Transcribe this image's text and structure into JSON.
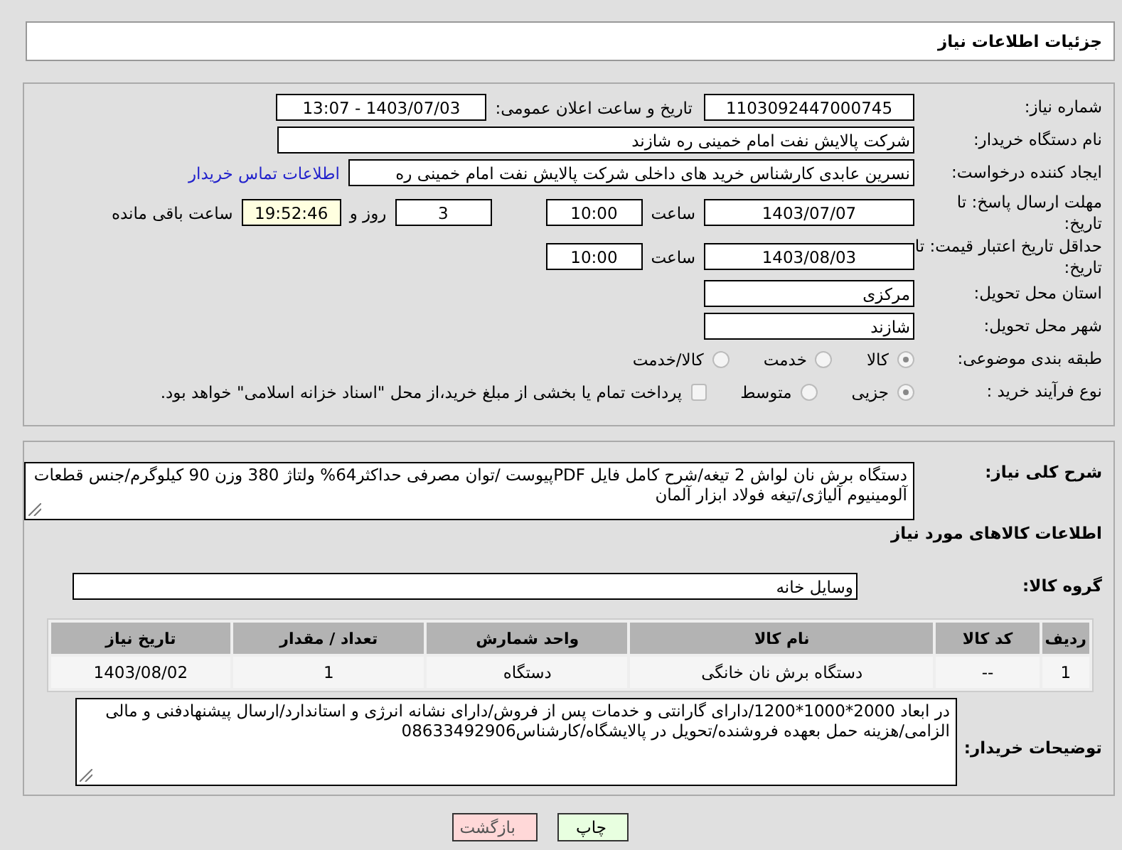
{
  "header": {
    "title": "جزئیات اطلاعات نیاز"
  },
  "need_number": {
    "label": "شماره نیاز:",
    "value": "1103092447000745"
  },
  "announce": {
    "label": "تاریخ و ساعت اعلان عمومی:",
    "value": "1403/07/03 - 13:07"
  },
  "buyer": {
    "label": "نام دستگاه خریدار:",
    "value": "شرکت پالایش نفت امام خمینی  ره  شازند"
  },
  "creator": {
    "label": "ایجاد کننده درخواست:",
    "value": "نسرین عابدی کارشناس خرید های داخلی  شرکت پالایش نفت امام خمینی  ره",
    "link": "اطلاعات تماس خریدار"
  },
  "deadline": {
    "label": "مهلت ارسال پاسخ: تا تاریخ:",
    "date": "1403/07/07",
    "time_label": "ساعت",
    "time": "10:00",
    "days": "3",
    "days_label": "روز و",
    "remaining": "19:52:46",
    "remaining_label": "ساعت باقی مانده"
  },
  "validity": {
    "label": "حداقل تاریخ اعتبار قیمت: تا تاریخ:",
    "date": "1403/08/03",
    "time_label": "ساعت",
    "time": "10:00"
  },
  "province": {
    "label": "استان محل تحویل:",
    "value": "مرکزی"
  },
  "city": {
    "label": "شهر محل تحویل:",
    "value": "شازند"
  },
  "category": {
    "label": "طبقه بندی موضوعی:",
    "options": [
      {
        "label": "کالا",
        "selected": true
      },
      {
        "label": "خدمت",
        "selected": false
      },
      {
        "label": "کالا/خدمت",
        "selected": false
      }
    ]
  },
  "process": {
    "label": "نوع فرآیند خرید :",
    "options": [
      {
        "label": "جزیی",
        "selected": true
      },
      {
        "label": "متوسط",
        "selected": false
      }
    ],
    "payment": {
      "label": "پرداخت تمام یا بخشی از مبلغ خرید،از محل \"اسناد خزانه اسلامی\" خواهد بود.",
      "checked": false
    }
  },
  "description": {
    "label": "شرح کلی نیاز:",
    "value": "دستگاه برش نان لواش 2 تیغه/شرح کامل فایل PDFپیوست /توان مصرفی حداکثر64% ولتاژ 380 وزن 90 کیلوگرم/جنس قطعات آلومینیوم آلیاژی/تیغه فولاد ابزار آلمان"
  },
  "goods_title": "اطلاعات کالاهای مورد نیاز",
  "goods_group": {
    "label": "گروه کالا:",
    "value": "وسایل خانه"
  },
  "table": {
    "columns": [
      "ردیف",
      "کد کالا",
      "نام کالا",
      "واحد شمارش",
      "تعداد / مقدار",
      "تاریخ نیاز"
    ],
    "rows": [
      [
        "1",
        "--",
        "دستگاه برش نان خانگی",
        "دستگاه",
        "1",
        "1403/08/02"
      ]
    ]
  },
  "buyer_notes": {
    "label": "توضیحات خریدار:",
    "value": "در ابعاد 2000*1000*1200/دارای گارانتی و خدمات پس از فروش/دارای نشانه انرژی و استاندارد/ارسال پیشنهادفنی و مالی الزامی/هزینه حمل بعهده فروشنده/تحویل در پالایشگاه/کارشناس08633492906"
  },
  "buttons": [
    {
      "label": "چاپ",
      "kind": "print"
    },
    {
      "label": "بازگشت",
      "kind": "back"
    }
  ]
}
